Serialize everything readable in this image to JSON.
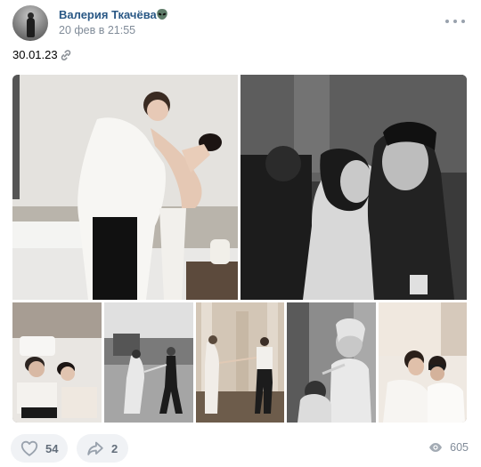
{
  "post": {
    "author": "Валерия Ткачёва",
    "date": "20 фев в 21:55",
    "text": "30.01.23"
  },
  "photos": [
    {
      "id": 1
    },
    {
      "id": 2
    },
    {
      "id": 3
    },
    {
      "id": 4
    },
    {
      "id": 5
    },
    {
      "id": 6
    },
    {
      "id": 7
    }
  ],
  "footer": {
    "likes": "54",
    "shares": "2",
    "views": "605"
  },
  "icons": {
    "status": "alien-icon",
    "text_link": "link-icon",
    "like": "heart-icon",
    "share": "share-arrow-icon",
    "views": "eye-icon",
    "menu": "more-dots-icon"
  },
  "colors": {
    "author": "#2a5885",
    "secondary": "#818c99",
    "button_bg": "#f0f2f5",
    "icon": "#99a2ad"
  }
}
